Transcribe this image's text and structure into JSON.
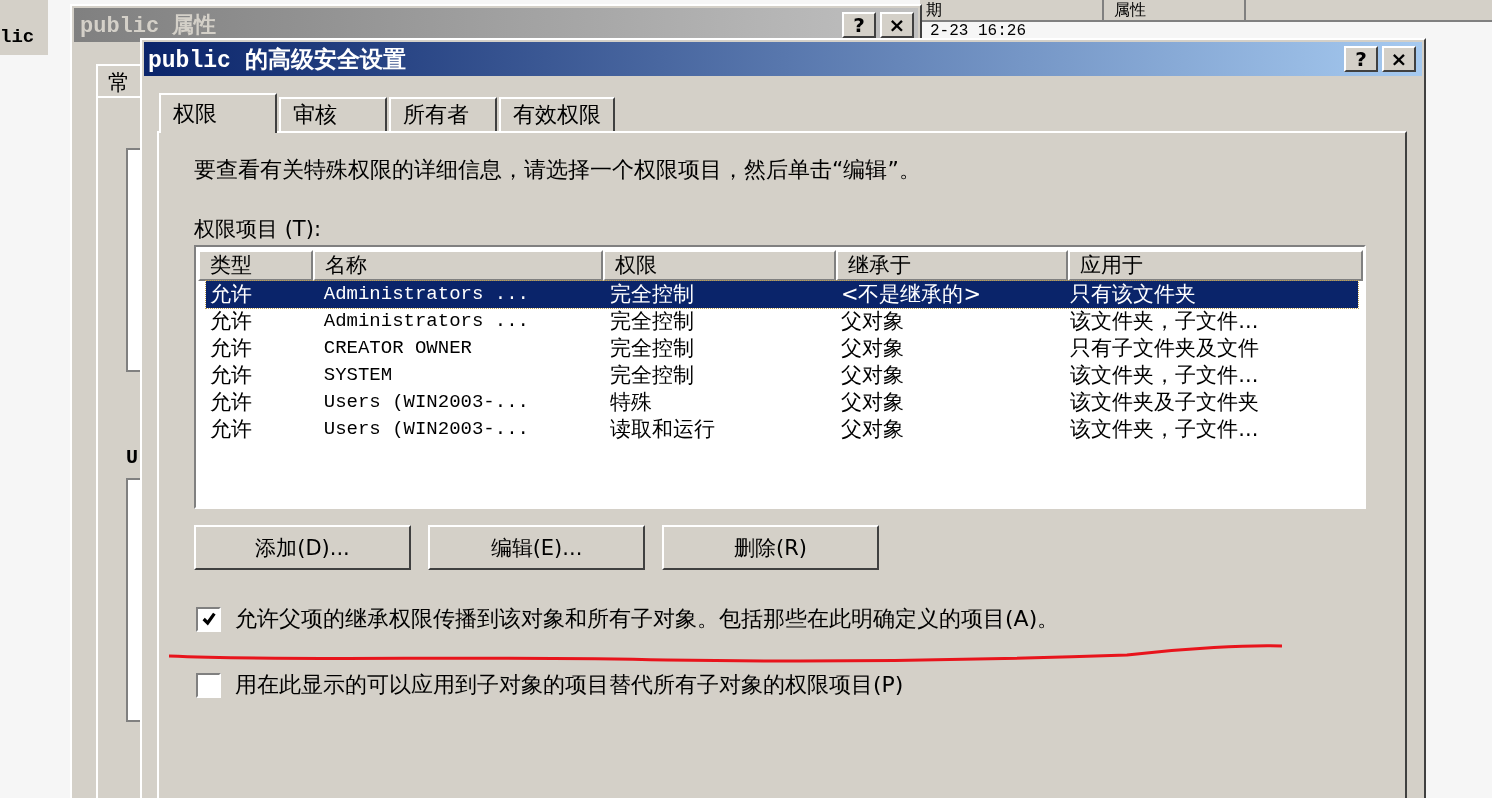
{
  "background_window": {
    "side_item": "lic",
    "columns": [
      {
        "label": "期"
      },
      {
        "label": "属性"
      }
    ],
    "date_text": "2-23 16:26"
  },
  "back_dialog": {
    "title": "public 属性",
    "help_button": "?",
    "close_button": "×",
    "tab": "常",
    "field_label": "U"
  },
  "dialog": {
    "title": "public 的高级安全设置",
    "help_button": "?",
    "close_button": "×",
    "tabs": [
      {
        "label": "权限",
        "selected": true
      },
      {
        "label": "审核",
        "selected": false
      },
      {
        "label": "所有者",
        "selected": false
      },
      {
        "label": "有效权限",
        "selected": false
      }
    ],
    "instruction": "要查看有关特殊权限的详细信息，请选择一个权限项目，然后单击“编辑”。",
    "list_label": "权限项目 (T):",
    "table": {
      "columns": [
        "类型",
        "名称",
        "权限",
        "继承于",
        "应用于"
      ],
      "rows": [
        {
          "cells": [
            "允许",
            "Administrators ...",
            "完全控制",
            "<不是继承的>",
            "只有该文件夹"
          ],
          "selected": true
        },
        {
          "cells": [
            "允许",
            "Administrators ...",
            "完全控制",
            "父对象",
            "该文件夹，子文件..."
          ],
          "selected": false
        },
        {
          "cells": [
            "允许",
            "CREATOR OWNER",
            "完全控制",
            "父对象",
            "只有子文件夹及文件"
          ],
          "selected": false
        },
        {
          "cells": [
            "允许",
            "SYSTEM",
            "完全控制",
            "父对象",
            "该文件夹，子文件..."
          ],
          "selected": false
        },
        {
          "cells": [
            "允许",
            "Users (WIN2003-...",
            "特殊",
            "父对象",
            "该文件夹及子文件夹"
          ],
          "selected": false
        },
        {
          "cells": [
            "允许",
            "Users (WIN2003-...",
            "读取和运行",
            "父对象",
            "该文件夹，子文件..."
          ],
          "selected": false
        }
      ]
    },
    "buttons": [
      "添加(D)...",
      "编辑(E)...",
      "删除(R)"
    ],
    "options": [
      {
        "label": "允许父项的继承权限传播到该对象和所有子对象。包括那些在此明确定义的项目(A)。",
        "checked": true
      },
      {
        "label": "用在此显示的可以应用到子对象的项目替代所有子对象的权限项目(P)",
        "checked": false
      }
    ]
  }
}
